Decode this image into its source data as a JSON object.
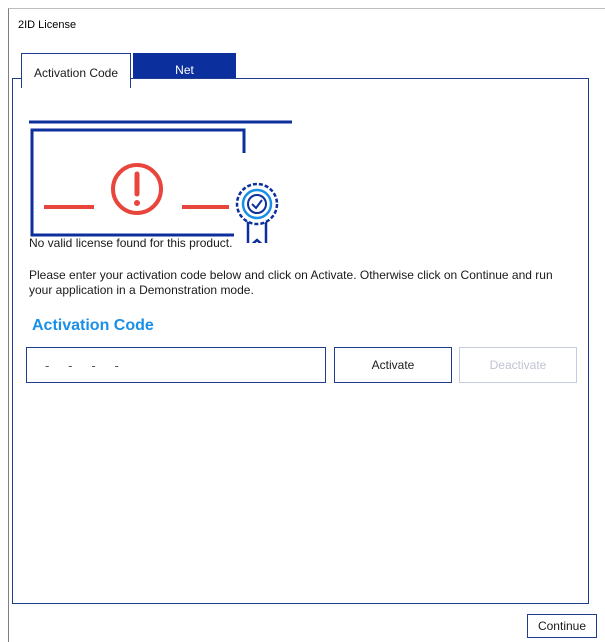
{
  "window": {
    "title": "2ID License"
  },
  "tabs": [
    {
      "label": "Activation Code",
      "selected": true
    },
    {
      "label": "Net",
      "selected": false
    }
  ],
  "banner": {
    "icons": [
      "license-error-icon",
      "warning-exclamation-icon",
      "certificate-badge-icon"
    ]
  },
  "message": {
    "no_license": "No valid license found for this product.",
    "instructions": "Please enter your activation code below and click on Activate. Otherwise click on Continue and run your application in a Demonstration mode."
  },
  "activation": {
    "heading": "Activation Code",
    "input_value": "-   -   -   -",
    "activate_label": "Activate",
    "deactivate_label": "Deactivate",
    "deactivate_enabled": false
  },
  "footer": {
    "continue_label": "Continue"
  },
  "colors": {
    "accent": "#1a8fe8",
    "tab_active_bg": "#0b2f9d",
    "border": "#1f3d8f",
    "error_red": "#e8453c"
  }
}
